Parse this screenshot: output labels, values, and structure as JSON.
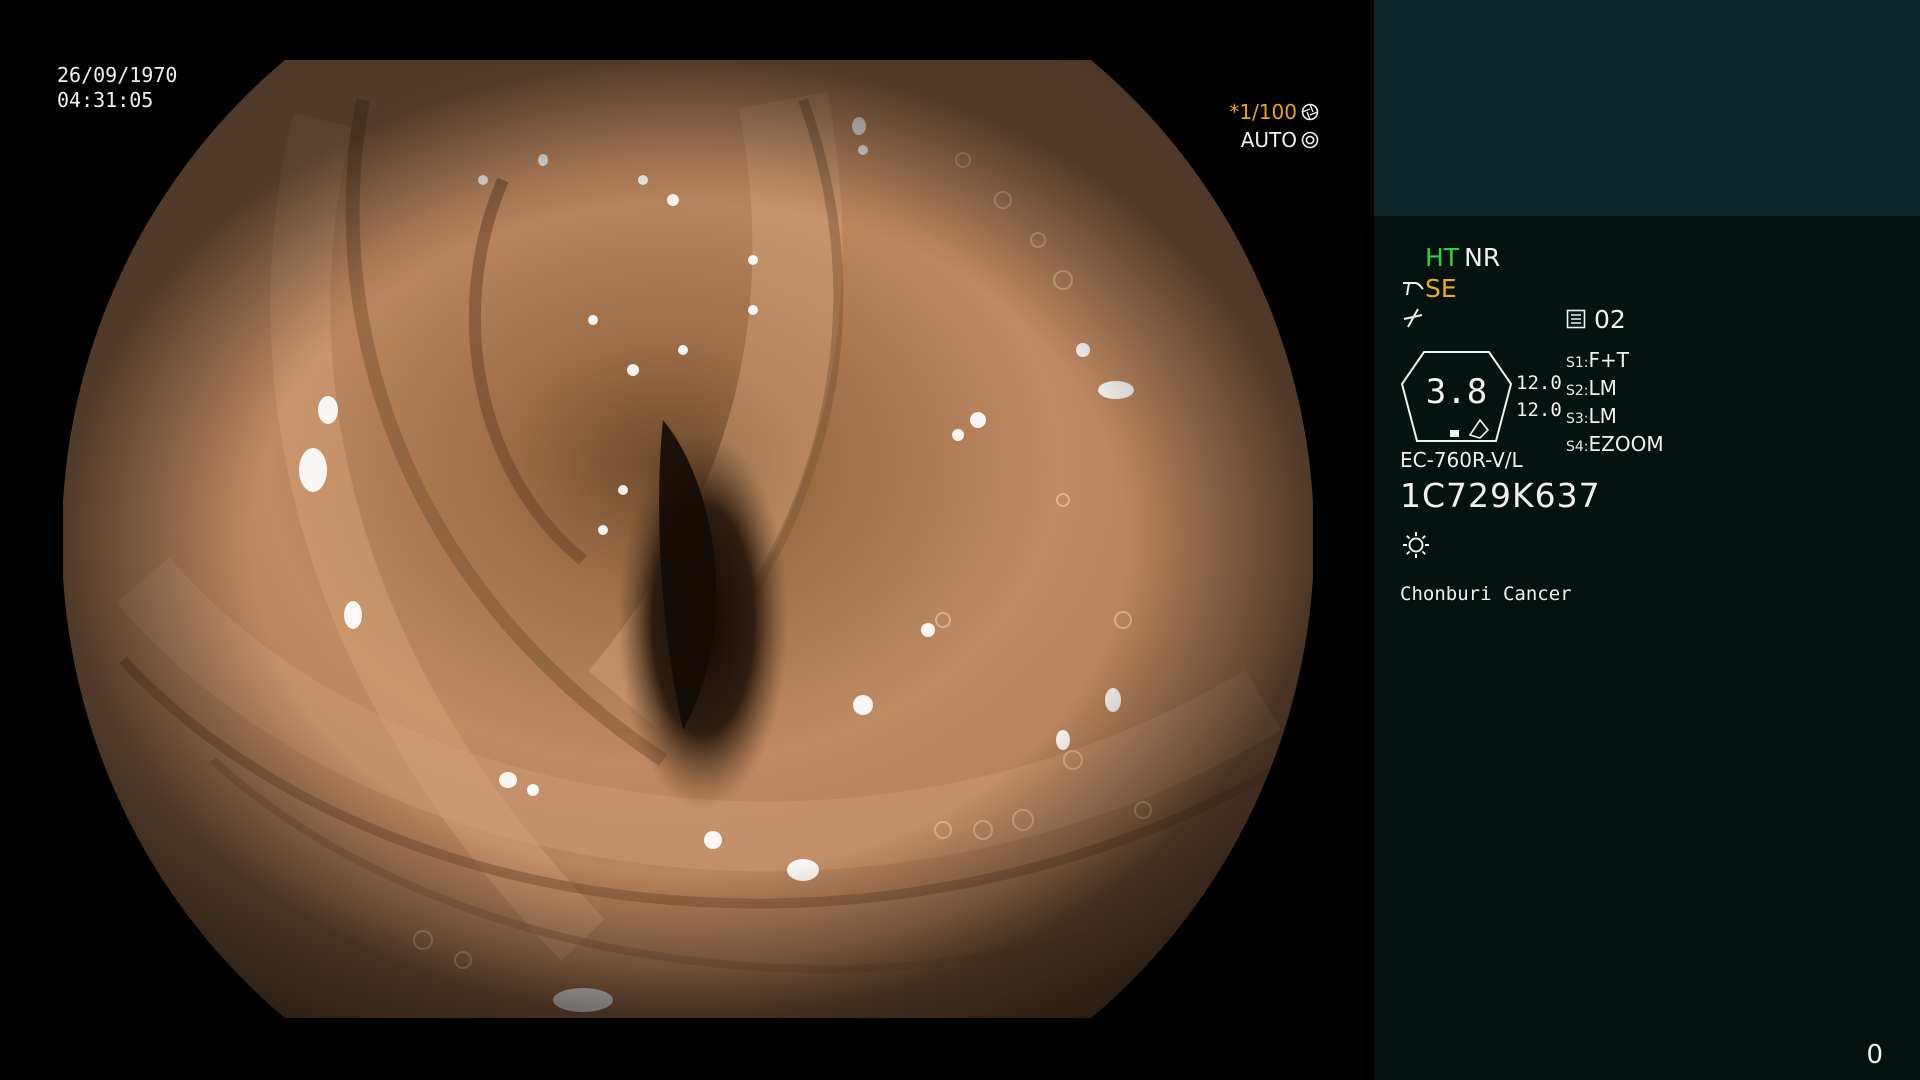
{
  "overlay": {
    "date": "26/09/1970",
    "time": "04:31:05",
    "shutter": "*1/100",
    "iris": "AUTO"
  },
  "panel": {
    "mode_ht": "HT",
    "mode_nr": "NR",
    "mode_se": "SE",
    "channel": "02",
    "zoom_value": "3.8",
    "num_top": "12.0",
    "num_bottom": "12.0",
    "switches": [
      {
        "key": "S1:",
        "value": "F+T"
      },
      {
        "key": "S2:",
        "value": "LM"
      },
      {
        "key": "S3:",
        "value": "LM"
      },
      {
        "key": "S4:",
        "value": "EZOOM"
      }
    ],
    "scope_model": "EC-760R-V/L",
    "scope_serial": "1C729K637",
    "hospital": "Chonburi Cancer",
    "counter": "0"
  },
  "icons": {
    "shutter": "aperture-icon",
    "iris": "iris-icon",
    "structure": "scope-tip-icon",
    "color": "wave-icon",
    "channel": "memo-icon",
    "light": "sun-icon"
  },
  "colors": {
    "ht": "#2ad24a",
    "se": "#f0a820",
    "shutter": "#f0a020",
    "panel_bg": "#041310",
    "panel_header": "#0d2628"
  }
}
